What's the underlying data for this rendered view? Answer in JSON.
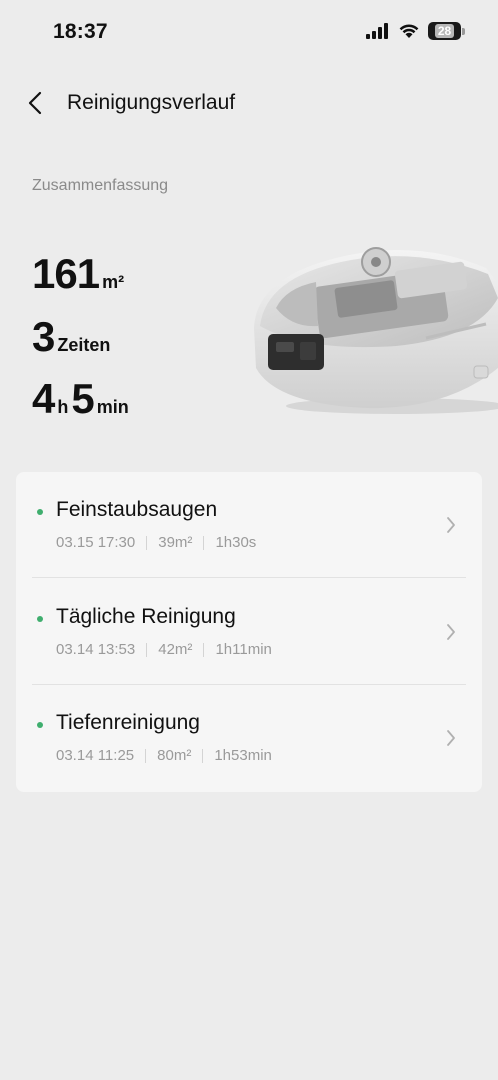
{
  "status_bar": {
    "time": "18:37",
    "battery": "28"
  },
  "header": {
    "title": "Reinigungsverlauf"
  },
  "summary": {
    "label": "Zusammenfassung",
    "area_value": "161",
    "area_unit": "m²",
    "count_value": "3",
    "count_unit": "Zeiten",
    "hours_value": "4",
    "hours_unit": "h",
    "minutes_value": "5",
    "minutes_unit": "min"
  },
  "records": [
    {
      "title": "Feinstaubsaugen",
      "date": "03.15 17:30",
      "area": "39m²",
      "duration": "1h30s"
    },
    {
      "title": "Tägliche Reinigung",
      "date": "03.14 13:53",
      "area": "42m²",
      "duration": "1h11min"
    },
    {
      "title": "Tiefenreinigung",
      "date": "03.14 11:25",
      "area": "80m²",
      "duration": "1h53min"
    }
  ],
  "colors": {
    "accent": "#3fae6e",
    "background": "#ececec",
    "card": "#f6f6f6"
  }
}
